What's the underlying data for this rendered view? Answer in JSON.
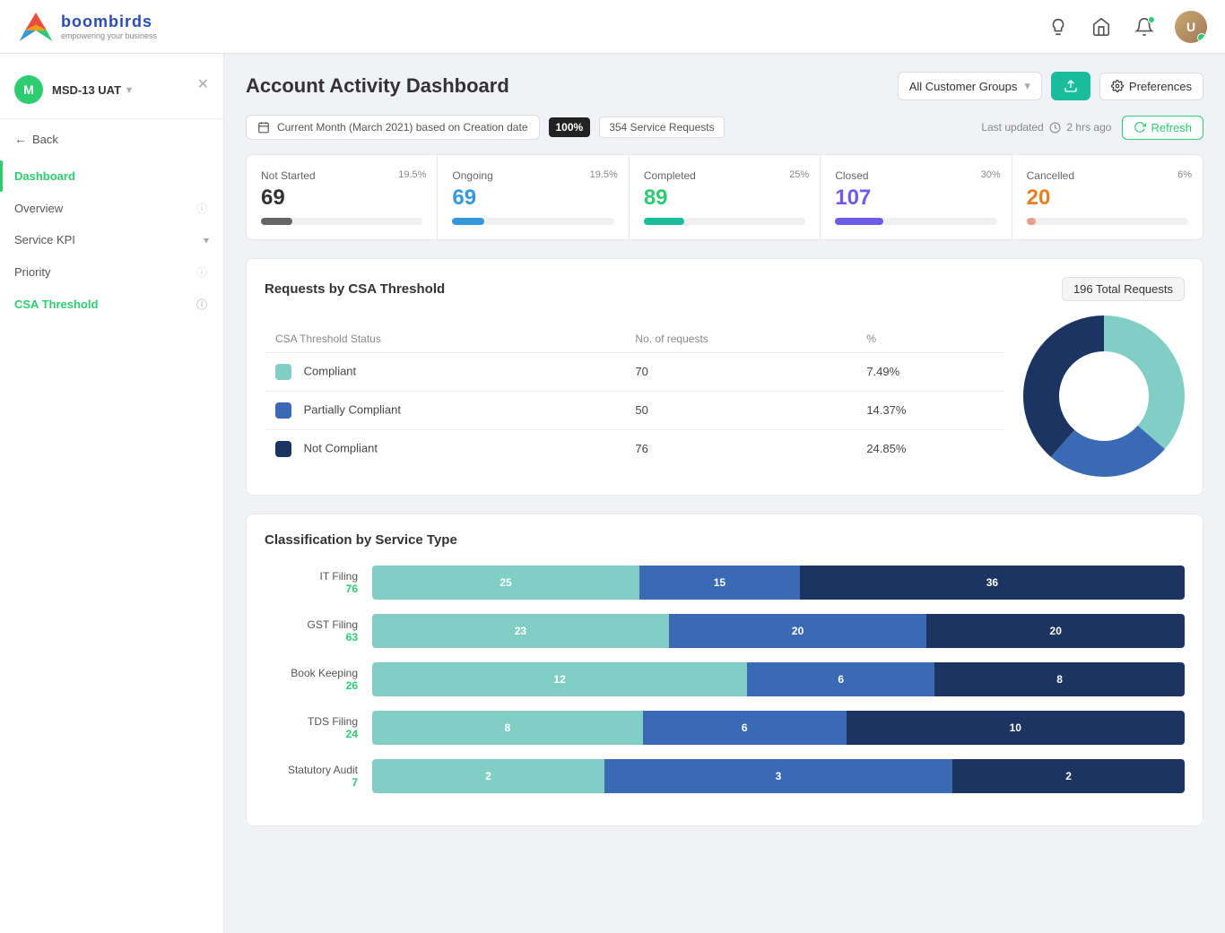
{
  "app": {
    "name": "boombirds",
    "tagline": "empowering your business"
  },
  "topnav": {
    "account": "MSD-13 UAT",
    "icons": [
      "bulb-icon",
      "home-icon",
      "bell-icon"
    ],
    "avatar_initials": "U"
  },
  "sidebar": {
    "account_name": "MSD-13 UAT",
    "back_label": "Back",
    "nav_items": [
      {
        "label": "Dashboard",
        "active": true,
        "has_info": false
      },
      {
        "label": "Overview",
        "active": false,
        "has_info": true
      },
      {
        "label": "Service KPI",
        "active": false,
        "has_chevron": true
      },
      {
        "label": "Priority",
        "active": false,
        "has_info": true
      },
      {
        "label": "CSA Threshold",
        "active": false,
        "has_info": true,
        "highlighted": true
      }
    ]
  },
  "page": {
    "title": "Account Activity Dashboard",
    "customer_groups_label": "All Customer Groups",
    "preferences_label": "Preferences",
    "date_label": "Current Month (March 2021) based on Creation date",
    "percent_label": "100%",
    "requests_label": "354 Service Requests",
    "last_updated": "Last updated",
    "last_updated_time": "2 hrs ago",
    "refresh_label": "Refresh"
  },
  "status_cards": [
    {
      "label": "Not Started",
      "value": "69",
      "percent": "19.5%",
      "bar_class": "bar-gray",
      "value_class": "dark"
    },
    {
      "label": "Ongoing",
      "value": "69",
      "percent": "19.5%",
      "bar_class": "bar-blue",
      "value_class": "blue"
    },
    {
      "label": "Completed",
      "value": "89",
      "percent": "25%",
      "bar_class": "bar-teal",
      "value_class": "green"
    },
    {
      "label": "Closed",
      "value": "107",
      "percent": "30%",
      "bar_class": "bar-purple",
      "value_class": "purple"
    },
    {
      "label": "Cancelled",
      "value": "20",
      "percent": "6%",
      "bar_class": "bar-salmon",
      "value_class": "orange"
    }
  ],
  "csa_section": {
    "title": "Requests by CSA Threshold",
    "total_label": "196 Total Requests",
    "columns": [
      "CSA Threshold Status",
      "No. of requests",
      "%"
    ],
    "rows": [
      {
        "label": "Compliant",
        "dot": "teal",
        "count": "70",
        "percent": "7.49%"
      },
      {
        "label": "Partially Compliant",
        "dot": "blue",
        "count": "50",
        "percent": "14.37%"
      },
      {
        "label": "Not Compliant",
        "dot": "darkblue",
        "count": "76",
        "percent": "24.85%"
      }
    ],
    "pie": {
      "teal_deg": 130,
      "blue_deg": 65,
      "dark_deg": 165
    }
  },
  "classification_section": {
    "title": "Classification by Service Type",
    "bars": [
      {
        "name": "IT Filing",
        "total": "76",
        "seg1": 25,
        "seg2": 15,
        "seg3": 36
      },
      {
        "name": "GST Filing",
        "total": "63",
        "seg1": 23,
        "seg2": 20,
        "seg3": 20
      },
      {
        "name": "Book Keeping",
        "total": "26",
        "seg1": 12,
        "seg2": 6,
        "seg3": 8
      },
      {
        "name": "TDS Filing",
        "total": "24",
        "seg1": 8,
        "seg2": 6,
        "seg3": 10
      },
      {
        "name": "Statutory Audit",
        "total": "7",
        "seg1": 2,
        "seg2": 3,
        "seg3": 2
      }
    ]
  }
}
